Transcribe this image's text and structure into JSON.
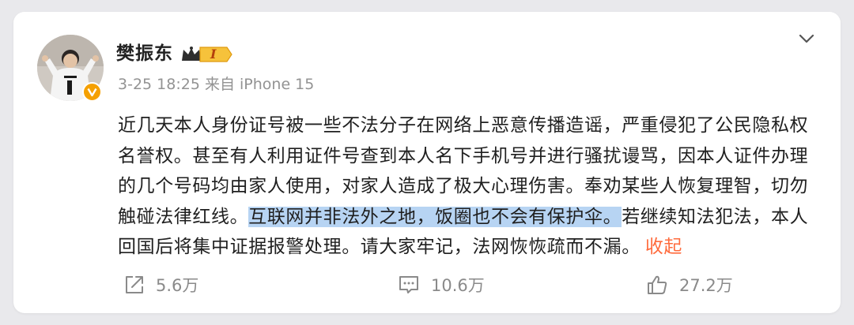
{
  "post": {
    "author": {
      "name": "樊振东",
      "level_badge": "I"
    },
    "meta": {
      "text": "3-25 18:25 来自 iPhone 15"
    },
    "content": {
      "part1": "近几天本人身份证号被一些不法分子在网络上恶意传播造谣，严重侵犯了公民隐私权名誉权。甚至有人利用证件号查到本人名下手机号并进行骚扰谩骂，因本人证件办理的几个号码均由家人使用，对家人造成了极大心理伤害。奉劝某些人恢复理智，切勿触碰法律红线。",
      "highlight": "互联网并非法外之地，饭圈也不会有保护伞。",
      "part2": "若继续知法犯法，本人回国后将集中证据报警处理。请大家牢记，法网恢恢疏而不漏。",
      "collapse": "收起"
    },
    "actions": {
      "share": "5.6万",
      "comment": "10.6万",
      "like": "27.2万"
    }
  },
  "colors": {
    "background": "#e9e9ec",
    "card": "#ffffff",
    "text": "#1f1f1f",
    "meta": "#939393",
    "highlight": "#b7d4f3",
    "link": "#ff6b3d",
    "badge_gold": "#f5a000"
  },
  "icons": [
    "chevron-down-icon",
    "share-icon",
    "comment-icon",
    "like-icon",
    "verified-badge-icon",
    "level-crown-icon"
  ]
}
